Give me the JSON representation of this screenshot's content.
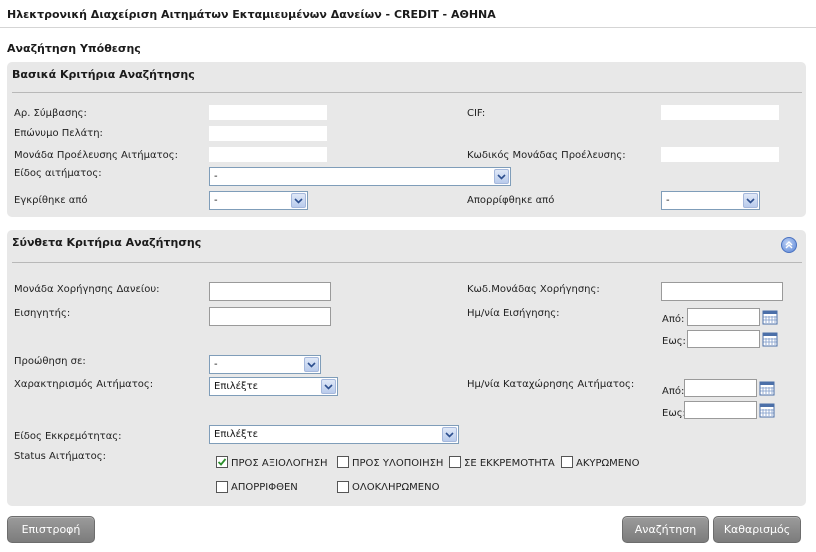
{
  "app_title": "Ηλεκτρονική Διαχείριση Αιτημάτων Εκταμιευμένων Δανείων - CREDIT - ΑΘΗΝΑ",
  "page_title": "Αναζήτηση Υπόθεσης",
  "basic": {
    "title": "Βασικά Κριτήρια Αναζήτησης",
    "contract_no_label": "Αρ. Σύμβασης:",
    "contract_no_value": "",
    "cif_label": "CIF:",
    "cif_value": "",
    "surname_label": "Επώνυμο Πελάτη:",
    "surname_value": "",
    "origin_unit_label": "Μονάδα Προέλευσης Αιτήματος:",
    "origin_unit_value": "",
    "origin_code_label": "Κωδικός Μονάδας Προέλευσης:",
    "origin_code_value": "",
    "request_type_label": "Είδος αιτήματος:",
    "request_type_value": "-",
    "approved_by_label": "Εγκρίθηκε από",
    "approved_by_value": "-",
    "rejected_by_label": "Απορρίφθηκε από",
    "rejected_by_value": "-"
  },
  "complex": {
    "title": "Σύνθετα Κριτήρια Αναζήτησης",
    "lending_unit_label": "Μονάδα Χορήγησης Δανείου:",
    "lending_unit_value": "",
    "lending_code_label": "Κωδ.Μονάδας Χορήγησης:",
    "lending_code_value": "",
    "rapporteur_label": "Εισηγητής:",
    "rapporteur_value": "",
    "proposal_date_label": "Ημ/νία Εισήγησης:",
    "from_label": "Από:",
    "to_label": "Εως:",
    "forward_label": "Προώθηση σε:",
    "forward_value": "-",
    "characterization_label": "Χαρακτηρισμός Αιτήματος:",
    "characterization_value": "Επιλέξτε",
    "registration_date_label": "Ημ/νία Καταχώρησης Αιτήματος:",
    "pending_type_label": "Είδος Εκκρεμότητας:",
    "pending_type_value": "Επιλέξτε",
    "status_label": "Status Αιτήματος:",
    "statuses": [
      {
        "label": "ΠΡΟΣ ΑΞΙΟΛΟΓΗΣΗ",
        "checked": true
      },
      {
        "label": "ΠΡΟΣ ΥΛΟΠΟΙΗΣΗ",
        "checked": false
      },
      {
        "label": "ΣΕ ΕΚΚΡΕΜΟΤΗΤΑ",
        "checked": false
      },
      {
        "label": "ΑΚΥΡΩΜΕΝΟ",
        "checked": false
      },
      {
        "label": "ΑΠΟΡΡΙΦΘΕΝ",
        "checked": false
      },
      {
        "label": "ΟΛΟΚΛΗΡΩΜΕΝΟ",
        "checked": false
      }
    ]
  },
  "buttons": {
    "back": "Επιστροφή",
    "search": "Αναζήτηση",
    "clear": "Καθαρισμός"
  },
  "colors": {
    "panel_bg": "#e8e8e8",
    "button_bg": "#8a8a8a",
    "select_border": "#7f9db9"
  }
}
